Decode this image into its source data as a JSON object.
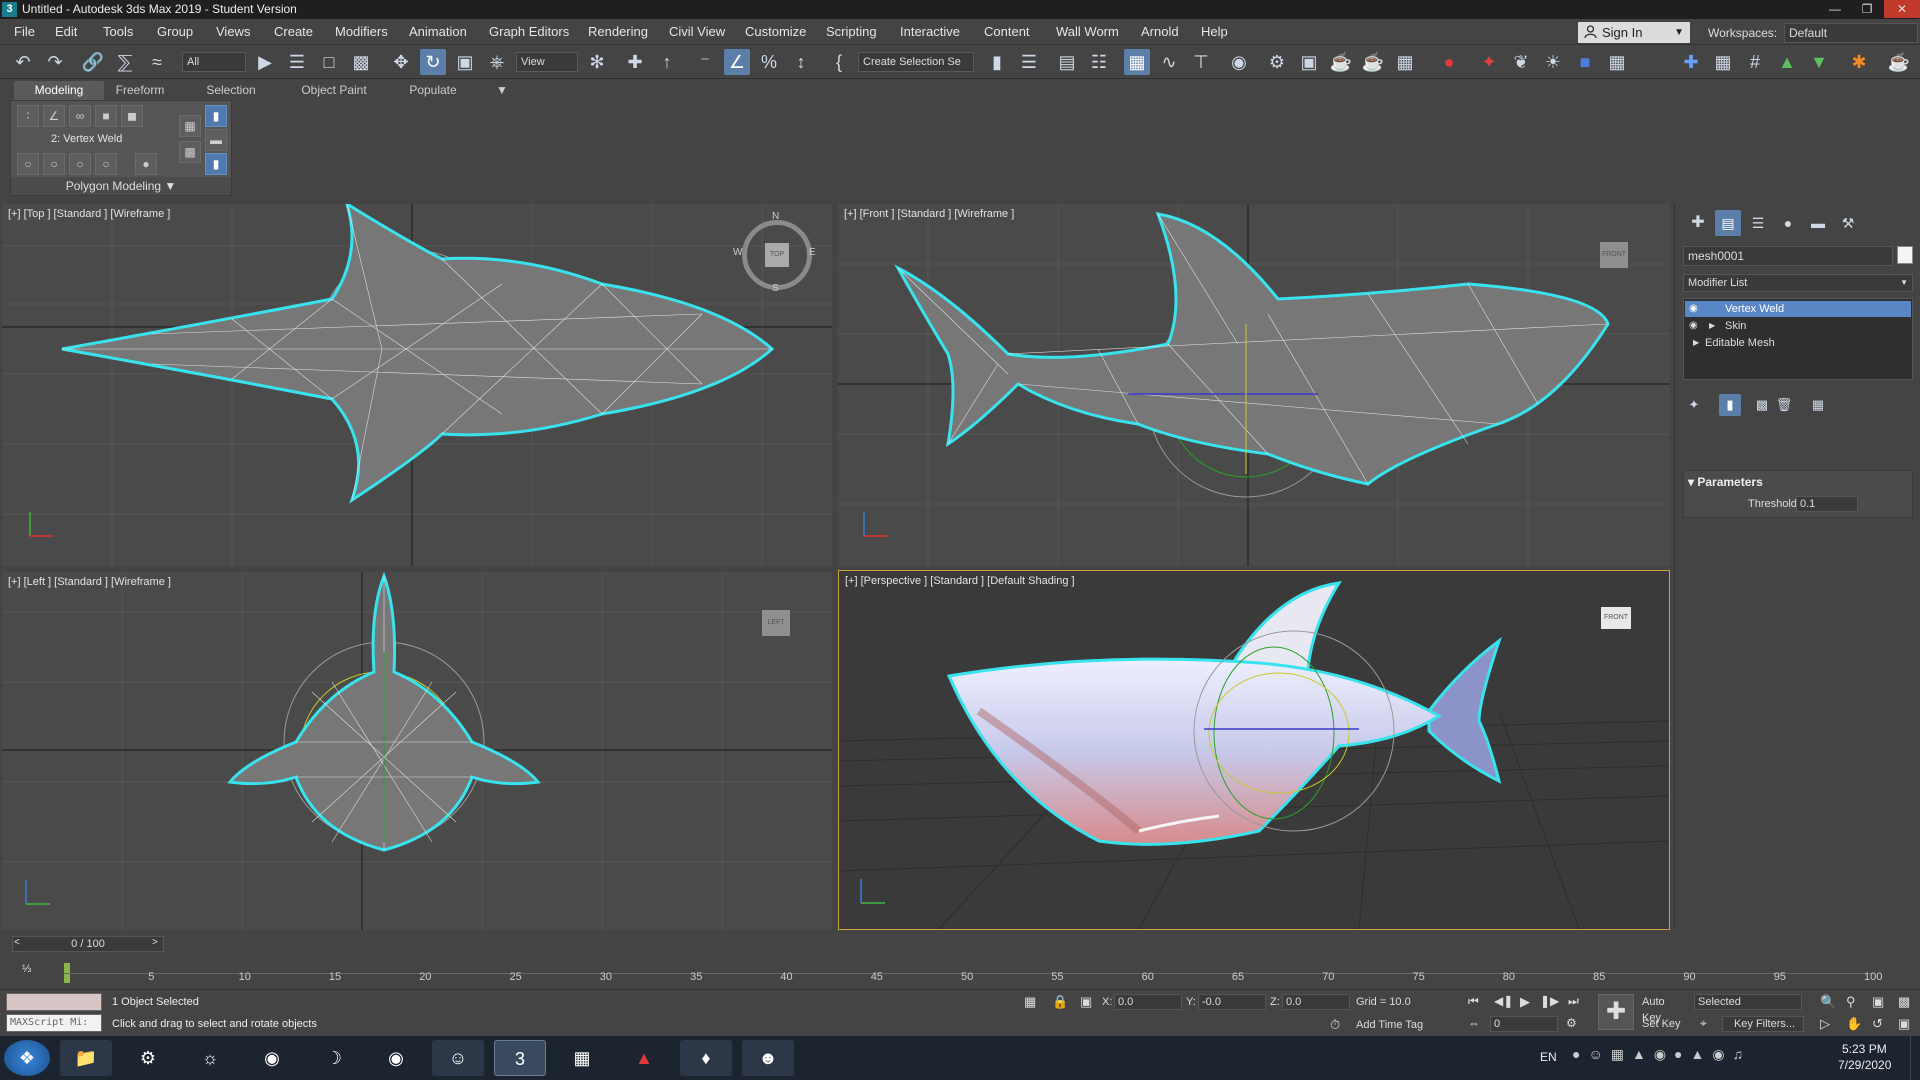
{
  "window": {
    "title": "Untitled - Autodesk 3ds Max 2019 - Student Version",
    "app_icon": "3"
  },
  "menu": [
    "File",
    "Edit",
    "Tools",
    "Group",
    "Views",
    "Create",
    "Modifiers",
    "Animation",
    "Graph Editors",
    "Rendering",
    "Civil View",
    "Customize",
    "Scripting",
    "Interactive",
    "Content",
    "Wall Worm",
    "Arnold",
    "Help"
  ],
  "account": {
    "sign_in": "Sign In",
    "workspaces_label": "Workspaces:",
    "workspace": "Default"
  },
  "toolbar": {
    "selection_filter": "All",
    "reference_coord": "View",
    "named_selection": "Create Selection Se"
  },
  "ribbon": {
    "tabs": [
      "Modeling",
      "Freeform",
      "Selection",
      "Object Paint",
      "Populate"
    ],
    "active_tab": "Modeling",
    "current_level": "2: Vertex Weld",
    "panel_label": "Polygon Modeling"
  },
  "viewports": {
    "top": {
      "label": "[+] [Top ] [Standard ] [Wireframe ]",
      "cube": "TOP",
      "compass": [
        "N",
        "S",
        "E",
        "W"
      ]
    },
    "front": {
      "label": "[+] [Front ] [Standard ] [Wireframe ]",
      "cube": "FRONT"
    },
    "left": {
      "label": "[+] [Left ] [Standard ] [Wireframe ]",
      "cube": "LEFT"
    },
    "perspective": {
      "label": "[+] [Perspective ] [Standard ] [Default Shading ]",
      "cube": "FRONT"
    }
  },
  "command_panel": {
    "object_name": "mesh0001",
    "modifier_list": "Modifier List",
    "stack": [
      "Vertex Weld",
      "Skin",
      "Editable Mesh"
    ],
    "selected_modifier": "Vertex Weld",
    "section": "Parameters",
    "threshold_label": "Threshold:",
    "threshold_value": "0.1"
  },
  "timeline": {
    "frame_display": "0 / 100",
    "ticks": [
      "5",
      "10",
      "15",
      "20",
      "25",
      "30",
      "35",
      "40",
      "45",
      "50",
      "55",
      "60",
      "65",
      "70",
      "75",
      "80",
      "85",
      "90",
      "95",
      "100"
    ]
  },
  "status": {
    "objects_selected": "1 Object Selected",
    "prompt": "Click and drag to select and rotate objects",
    "maxscript": "MAXScript Mi:",
    "x_label": "X:",
    "x_value": "0.0",
    "y_label": "Y:",
    "y_value": "-0.0",
    "z_label": "Z:",
    "z_value": "0.0",
    "grid": "Grid = 10.0",
    "add_time_tag": "Add Time Tag",
    "auto_key": "Auto Key",
    "set_key": "Set Key",
    "key_mode": "Selected",
    "key_filters": "Key Filters...",
    "frame_field": "0"
  },
  "taskbar": {
    "lang": "EN",
    "time": "5:23 PM",
    "date": "7/29/2020",
    "apps": [
      "Windows Explorer",
      "Steam",
      "Ubisoft",
      "Norton",
      "Firefox",
      "Chrome",
      "Discord",
      "3ds Max",
      "Spreadsheet",
      "Acrobat",
      "Inkscape",
      "GIMP"
    ]
  },
  "colors": {
    "selection_outline": "#39e3ee",
    "active_blue": "#5b86c5",
    "viewport_bg": "#4a4a4a",
    "persp_border": "#c9a53a"
  }
}
